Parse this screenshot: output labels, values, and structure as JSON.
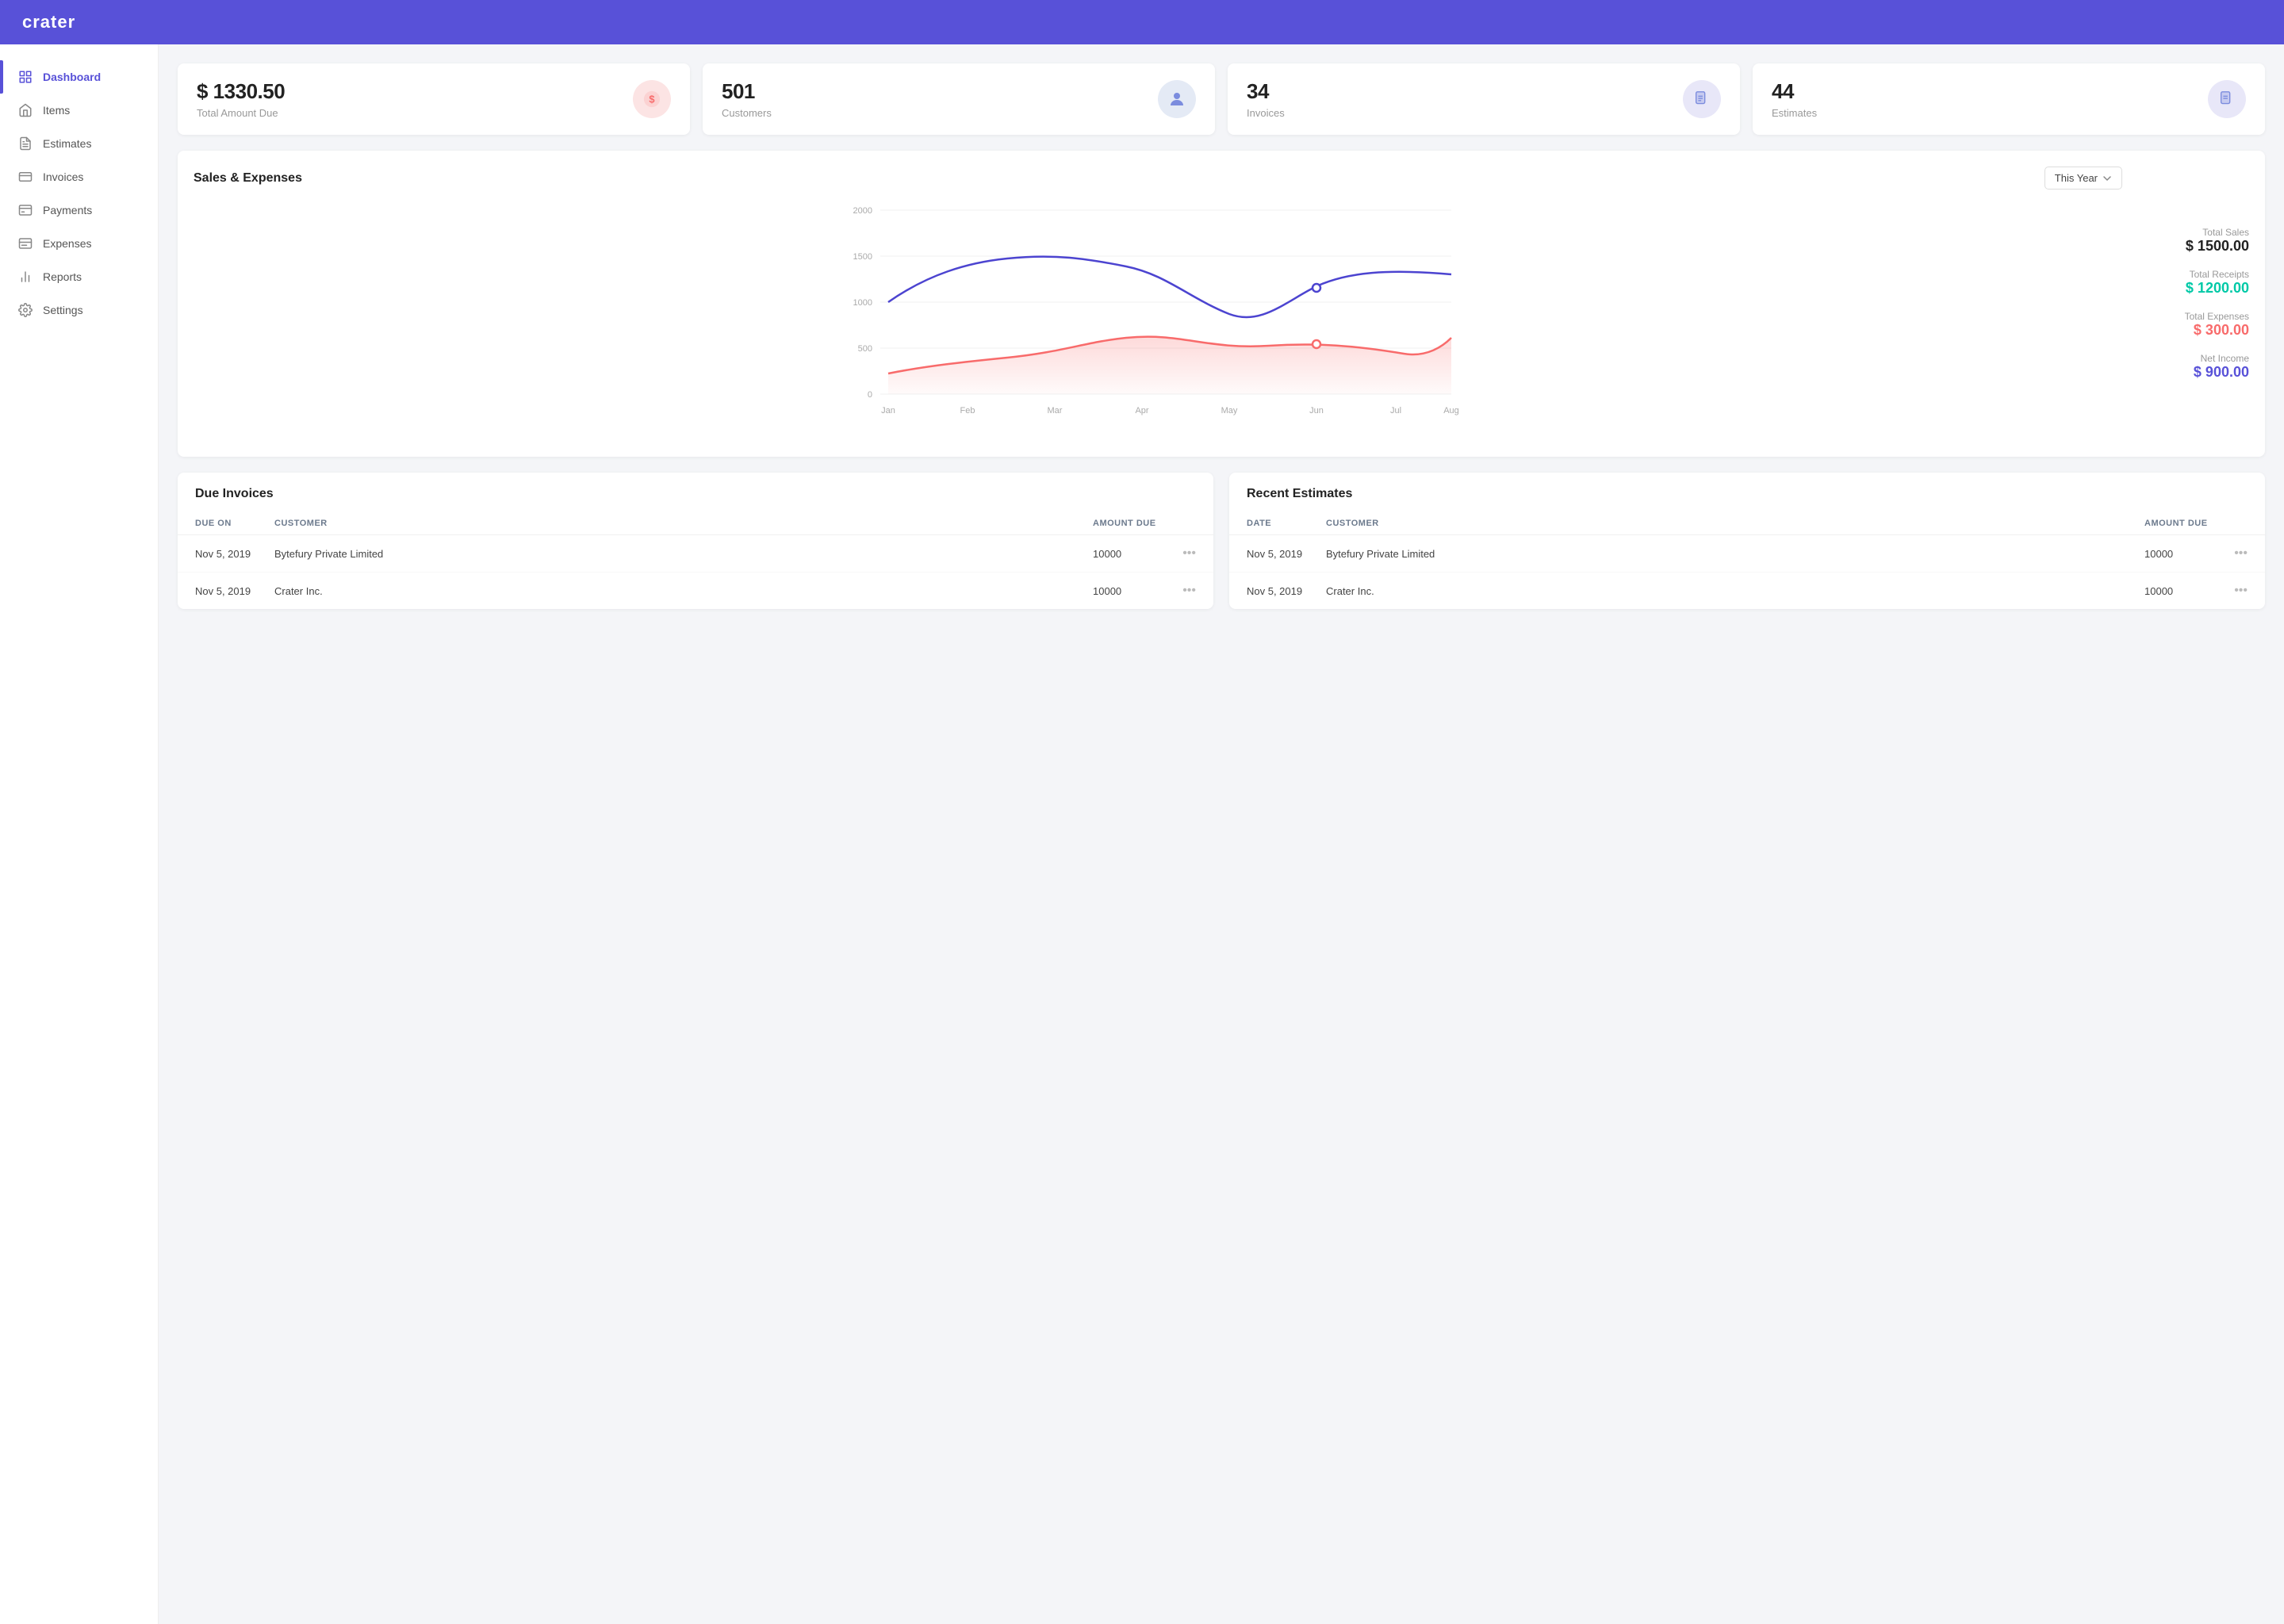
{
  "app": {
    "name": "crater"
  },
  "sidebar": {
    "items": [
      {
        "id": "dashboard",
        "label": "Dashboard",
        "active": true
      },
      {
        "id": "items",
        "label": "Items",
        "active": false
      },
      {
        "id": "estimates",
        "label": "Estimates",
        "active": false
      },
      {
        "id": "invoices",
        "label": "Invoices",
        "active": false
      },
      {
        "id": "payments",
        "label": "Payments",
        "active": false
      },
      {
        "id": "expenses",
        "label": "Expenses",
        "active": false
      },
      {
        "id": "reports",
        "label": "Reports",
        "active": false
      },
      {
        "id": "settings",
        "label": "Settings",
        "active": false
      }
    ]
  },
  "stats": [
    {
      "id": "amount-due",
      "value": "$ 1330.50",
      "label": "Total Amount Due",
      "icon_type": "dollar",
      "icon_color": "pink"
    },
    {
      "id": "customers",
      "value": "501",
      "label": "Customers",
      "icon_type": "user",
      "icon_color": "blue"
    },
    {
      "id": "invoices",
      "value": "34",
      "label": "Invoices",
      "icon_type": "invoice",
      "icon_color": "indigo"
    },
    {
      "id": "estimates",
      "value": "44",
      "label": "Estimates",
      "icon_type": "estimate",
      "icon_color": "indigo"
    }
  ],
  "chart": {
    "title": "Sales & Expenses",
    "filter": "This Year",
    "x_labels": [
      "Jan",
      "Feb",
      "Mar",
      "Apr",
      "May",
      "Jun",
      "Jul",
      "Aug"
    ],
    "y_labels": [
      "2000",
      "1500",
      "1000",
      "500",
      "0"
    ],
    "total_sales_label": "Total Sales",
    "total_sales_value": "$ 1500.00",
    "total_receipts_label": "Total Receipts",
    "total_receipts_value": "$ 1200.00",
    "total_expenses_label": "Total Expenses",
    "total_expenses_value": "$ 300.00",
    "net_income_label": "Net Income",
    "net_income_value": "$ 900.00"
  },
  "due_invoices": {
    "title": "Due Invoices",
    "columns": [
      "DUE ON",
      "CUSTOMER",
      "AMOUNT DUE",
      ""
    ],
    "rows": [
      {
        "due_on": "Nov 5, 2019",
        "customer": "Bytefury Private Limited",
        "amount": "10000"
      },
      {
        "due_on": "Nov 5, 2019",
        "customer": "Crater Inc.",
        "amount": "10000"
      }
    ]
  },
  "recent_estimates": {
    "title": "Recent Estimates",
    "columns": [
      "DATE",
      "CUSTOMER",
      "AMOUNT DUE",
      ""
    ],
    "rows": [
      {
        "date": "Nov 5, 2019",
        "customer": "Bytefury Private Limited",
        "amount": "10000"
      },
      {
        "date": "Nov 5, 2019",
        "customer": "Crater Inc.",
        "amount": "10000"
      }
    ]
  }
}
